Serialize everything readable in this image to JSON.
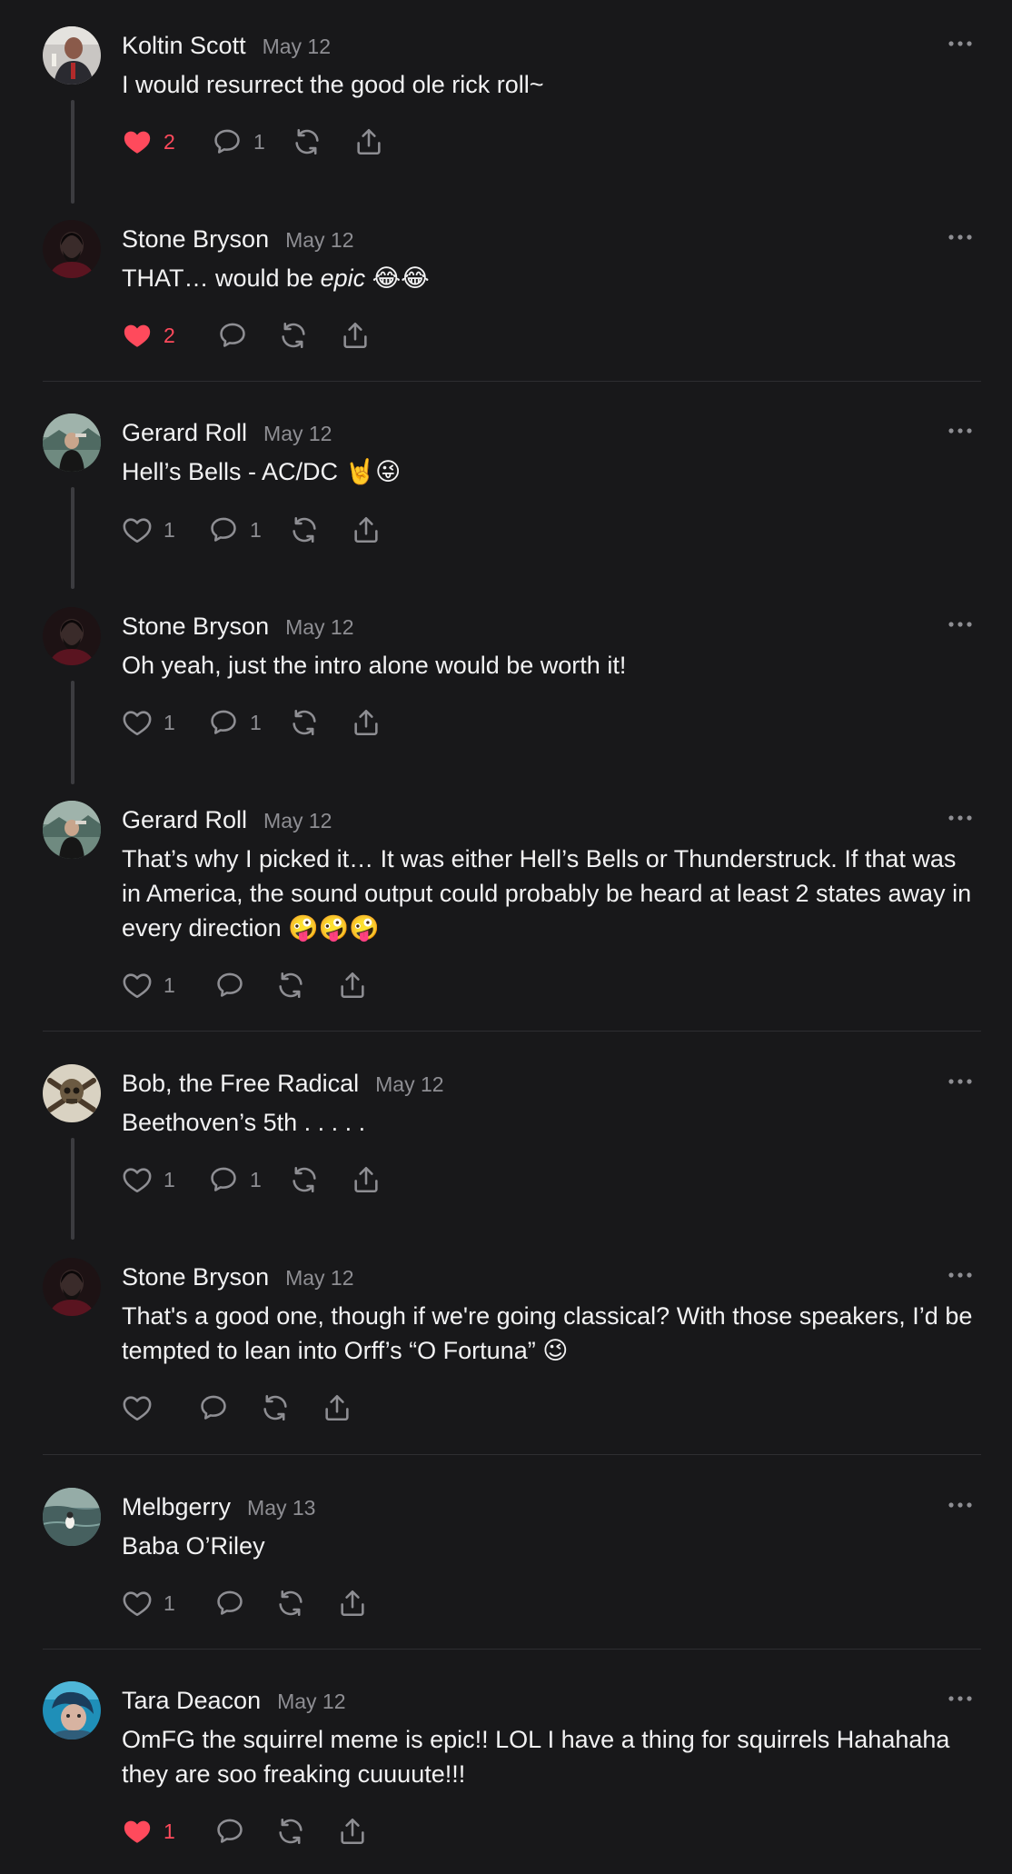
{
  "colors": {
    "background": "#18181a",
    "text_primary": "#f2f2f3",
    "text_secondary": "#8e8e93",
    "like_active": "#ff4a5c",
    "thread_line": "#3c3c40",
    "divider": "#2e2e31"
  },
  "icons": {
    "like": "heart-icon",
    "liked": "heart-filled-icon",
    "reply": "speech-bubble-icon",
    "repost": "repost-arrows-icon",
    "share": "share-upload-icon",
    "more": "more-dots-icon"
  },
  "posts": [
    {
      "author": "Koltin Scott",
      "date": "May 12",
      "text": "I would resurrect the good ole rick roll~",
      "liked": true,
      "likes": "2",
      "replies": "1",
      "avatar": "avatar-koltin-scott"
    },
    {
      "author": "Stone Bryson",
      "date": "May 12",
      "text_before": "THAT… would be ",
      "text_italic": "epic",
      "text_after": " 😂😂",
      "liked": true,
      "likes": "2",
      "replies": "",
      "avatar": "avatar-stone-bryson"
    },
    {
      "author": "Gerard Roll",
      "date": "May 12",
      "text": "Hell’s Bells - AC/DC 🤘😜",
      "liked": false,
      "likes": "1",
      "replies": "1",
      "avatar": "avatar-gerard-roll"
    },
    {
      "author": "Stone Bryson",
      "date": "May 12",
      "text": "Oh yeah, just the intro alone would be worth it!",
      "liked": false,
      "likes": "1",
      "replies": "1",
      "avatar": "avatar-stone-bryson"
    },
    {
      "author": "Gerard Roll",
      "date": "May 12",
      "text": "That’s why I picked it… It was either Hell’s Bells or Thunderstruck. If that was in America, the sound output could probably be heard at least 2 states away in every direction 🤪🤪🤪",
      "liked": false,
      "likes": "1",
      "replies": "",
      "avatar": "avatar-gerard-roll"
    },
    {
      "author": "Bob, the Free Radical",
      "date": "May 12",
      "text": "Beethoven’s 5th . . . . .",
      "liked": false,
      "likes": "1",
      "replies": "1",
      "avatar": "avatar-bob-free-radical"
    },
    {
      "author": "Stone Bryson",
      "date": "May 12",
      "text": "That's a good one, though if we're going classical? With those speakers, I’d be tempted to lean into Orff’s “O Fortuna” 😉",
      "liked": false,
      "likes": "",
      "replies": "",
      "avatar": "avatar-stone-bryson"
    },
    {
      "author": "Melbgerry",
      "date": "May 13",
      "text": "Baba O’Riley",
      "liked": false,
      "likes": "1",
      "replies": "",
      "avatar": "avatar-melbgerry"
    },
    {
      "author": "Tara Deacon",
      "date": "May 12",
      "text": "OmFG the squirrel meme is epic!! LOL I have a thing for squirrels Hahahaha they are soo freaking cuuuute!!!",
      "liked": true,
      "likes": "1",
      "replies": "",
      "avatar": "avatar-tara-deacon"
    }
  ]
}
